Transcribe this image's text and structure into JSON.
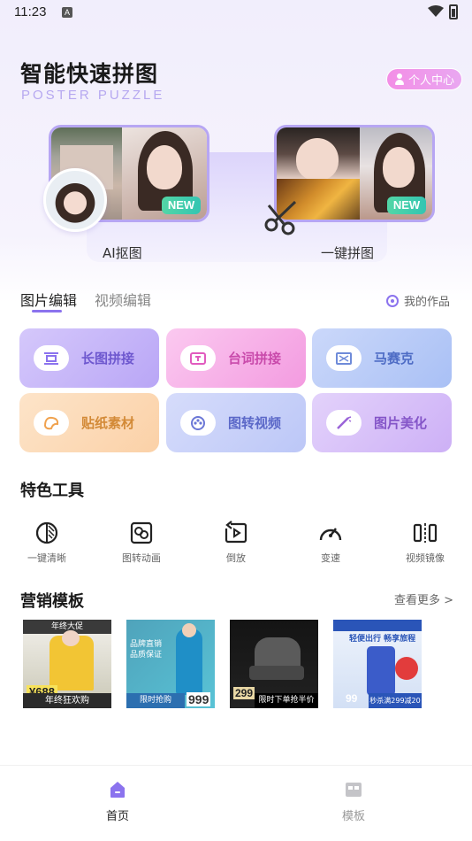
{
  "status_bar": {
    "time": "11:23",
    "notification_badge": "A"
  },
  "header": {
    "title": "智能快速拼图",
    "subtitle": "POSTER PUZZLE",
    "profile_button": "个人中心"
  },
  "hero": {
    "cards": [
      {
        "label": "AI抠图",
        "badge": "NEW"
      },
      {
        "label": "一键拼图",
        "badge": "NEW"
      }
    ]
  },
  "tabs": {
    "items": [
      "图片编辑",
      "视频编辑"
    ],
    "active_index": 0,
    "my_works": "我的作品"
  },
  "features": [
    {
      "label": "长图拼接",
      "icon": "long-image-icon"
    },
    {
      "label": "台词拼接",
      "icon": "text-frame-icon"
    },
    {
      "label": "马赛克",
      "icon": "mosaic-icon"
    },
    {
      "label": "贴纸素材",
      "icon": "sticker-icon"
    },
    {
      "label": "图转视频",
      "icon": "film-reel-icon"
    },
    {
      "label": "图片美化",
      "icon": "magic-wand-icon"
    }
  ],
  "special_tools": {
    "title": "特色工具",
    "items": [
      {
        "label": "一键清晰",
        "icon": "contrast-icon"
      },
      {
        "label": "图转动画",
        "icon": "animation-icon"
      },
      {
        "label": "倒放",
        "icon": "rewind-icon"
      },
      {
        "label": "变速",
        "icon": "speedometer-icon"
      },
      {
        "label": "视频镜像",
        "icon": "mirror-icon"
      }
    ]
  },
  "marketing": {
    "title": "营销模板",
    "more": "查看更多 >",
    "templates": [
      {
        "price": "¥688",
        "bar_text": "年终狂欢购",
        "top_text": "年终大促"
      },
      {
        "price": "999",
        "bar_text": "限时抢购",
        "top_text": "品牌直销 品质保证"
      },
      {
        "price": "299",
        "bar_text": "限时下单抢半价",
        "top_text": ""
      },
      {
        "price": "99",
        "bar_text": "秒杀满299减20",
        "top_text": "轻便出行 畅享旅程"
      }
    ]
  },
  "bottom_nav": {
    "items": [
      {
        "label": "首页",
        "active": true
      },
      {
        "label": "模板",
        "active": false
      }
    ]
  },
  "colors": {
    "accent": "#8b73ee",
    "badge_green": "#3ccaa9",
    "profile_pink": "#f29be8"
  }
}
